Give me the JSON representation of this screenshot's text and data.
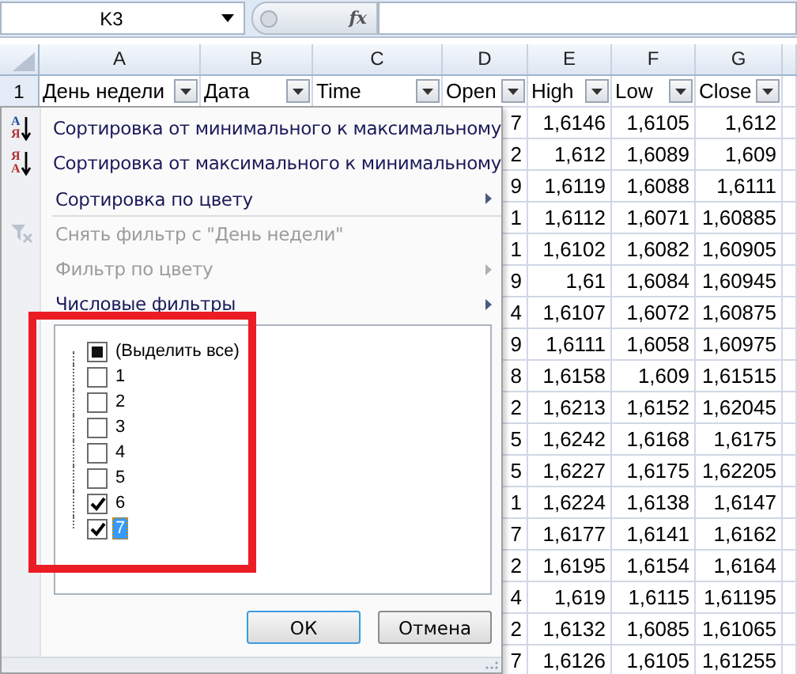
{
  "formula_bar": {
    "name_box": "K3",
    "fx_label": "fx"
  },
  "columns": [
    "A",
    "B",
    "C",
    "D",
    "E",
    "F",
    "G"
  ],
  "header_row": {
    "number": "1",
    "cells": [
      "День недели",
      "Дата",
      "Time",
      "Open",
      "High",
      "Low",
      "Close"
    ]
  },
  "rows": [
    {
      "d": "7",
      "high": "1,6146",
      "low": "1,6105",
      "close": "1,612"
    },
    {
      "d": "2",
      "high": "1,612",
      "low": "1,6089",
      "close": "1,609"
    },
    {
      "d": "9",
      "high": "1,6119",
      "low": "1,6088",
      "close": "1,6111"
    },
    {
      "d": "1",
      "high": "1,6112",
      "low": "1,6071",
      "close": "1,60885"
    },
    {
      "d": "1",
      "high": "1,6102",
      "low": "1,6082",
      "close": "1,60905"
    },
    {
      "d": "9",
      "high": "1,61",
      "low": "1,6084",
      "close": "1,60945"
    },
    {
      "d": "4",
      "high": "1,6107",
      "low": "1,6072",
      "close": "1,60875"
    },
    {
      "d": "9",
      "high": "1,6111",
      "low": "1,6058",
      "close": "1,60975"
    },
    {
      "d": "8",
      "high": "1,6158",
      "low": "1,609",
      "close": "1,61515"
    },
    {
      "d": "2",
      "high": "1,6213",
      "low": "1,6152",
      "close": "1,62045"
    },
    {
      "d": "5",
      "high": "1,6242",
      "low": "1,6168",
      "close": "1,6175"
    },
    {
      "d": "5",
      "high": "1,6227",
      "low": "1,6175",
      "close": "1,62205"
    },
    {
      "d": "1",
      "high": "1,6224",
      "low": "1,6138",
      "close": "1,6147"
    },
    {
      "d": "7",
      "high": "1,6177",
      "low": "1,6141",
      "close": "1,6162"
    },
    {
      "d": "2",
      "high": "1,6195",
      "low": "1,6154",
      "close": "1,6164"
    },
    {
      "d": "4",
      "high": "1,619",
      "low": "1,6115",
      "close": "1,61195"
    },
    {
      "d": "2",
      "high": "1,6132",
      "low": "1,6085",
      "close": "1,61065"
    },
    {
      "d": "7",
      "high": "1,6126",
      "low": "1,6105",
      "close": "1,61255"
    }
  ],
  "filter_menu": {
    "items": [
      {
        "label": "Сортировка от минимального к максимальному",
        "kind": "sort",
        "icon_letters": [
          "A",
          "Я"
        ],
        "disabled": false,
        "submenu": false,
        "separator_after": false
      },
      {
        "label": "Сортировка от максимального к минимальному",
        "kind": "sort",
        "icon_letters": [
          "Я",
          "A"
        ],
        "disabled": false,
        "submenu": false,
        "separator_after": false
      },
      {
        "label": "Сортировка по цвету",
        "kind": "plain",
        "disabled": false,
        "submenu": true,
        "separator_after": true
      },
      {
        "label": "Снять фильтр с \"День недели\"",
        "kind": "clear",
        "disabled": true,
        "submenu": false,
        "separator_after": false
      },
      {
        "label": "Фильтр по цвету",
        "kind": "plain",
        "disabled": true,
        "submenu": true,
        "separator_after": false
      },
      {
        "label": "Числовые фильтры",
        "kind": "plain",
        "disabled": false,
        "submenu": true,
        "separator_after": false
      }
    ],
    "values": [
      {
        "label": "(Выделить все)",
        "checked": false,
        "partial": true,
        "selected": false
      },
      {
        "label": "1",
        "checked": false,
        "selected": false
      },
      {
        "label": "2",
        "checked": false,
        "selected": false
      },
      {
        "label": "3",
        "checked": false,
        "selected": false
      },
      {
        "label": "4",
        "checked": false,
        "selected": false
      },
      {
        "label": "5",
        "checked": false,
        "selected": false
      },
      {
        "label": "6",
        "checked": true,
        "selected": false
      },
      {
        "label": "7",
        "checked": true,
        "selected": true
      }
    ],
    "buttons": [
      {
        "label": "ОК",
        "default": true
      },
      {
        "label": "Отмена",
        "default": false
      }
    ]
  }
}
